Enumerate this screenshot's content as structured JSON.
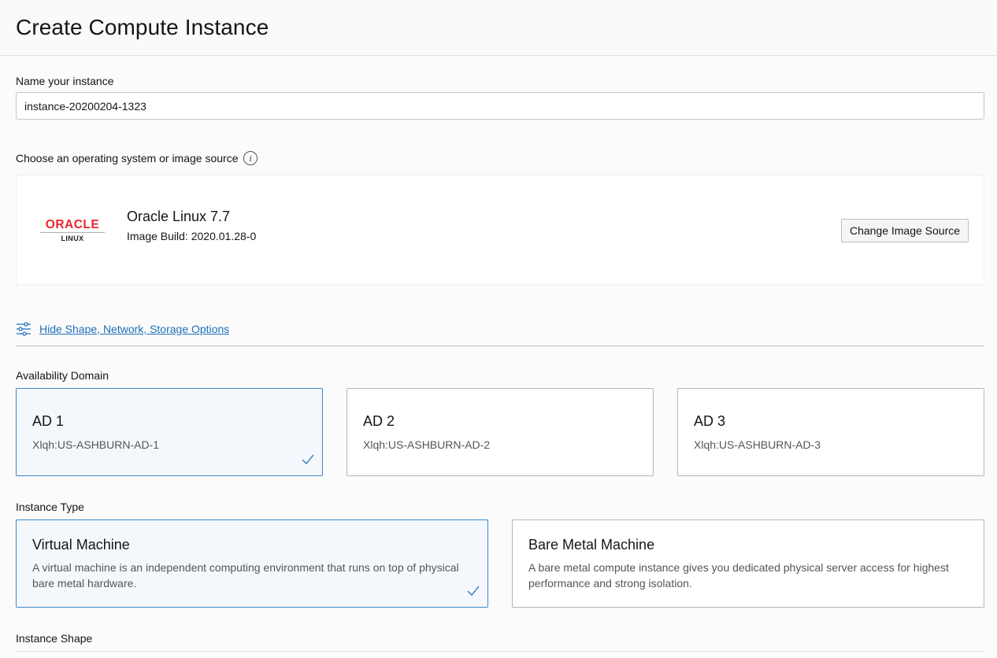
{
  "page": {
    "title": "Create Compute Instance"
  },
  "name_field": {
    "label": "Name your instance",
    "value": "instance-20200204-1323"
  },
  "image_source": {
    "label": "Choose an operating system or image source",
    "info_icon": "i",
    "logo": {
      "word": "ORACLE",
      "sub": "LINUX"
    },
    "os_name": "Oracle Linux 7.7",
    "build": "Image Build: 2020.01.28-0",
    "change_button": "Change Image Source"
  },
  "options_toggle": {
    "label": "Hide Shape, Network, Storage Options",
    "icon": "sliders-icon"
  },
  "availability_domain": {
    "label": "Availability Domain",
    "options": [
      {
        "title": "AD 1",
        "sub": "Xlqh:US-ASHBURN-AD-1",
        "selected": true
      },
      {
        "title": "AD 2",
        "sub": "Xlqh:US-ASHBURN-AD-2",
        "selected": false
      },
      {
        "title": "AD 3",
        "sub": "Xlqh:US-ASHBURN-AD-3",
        "selected": false
      }
    ]
  },
  "instance_type": {
    "label": "Instance Type",
    "options": [
      {
        "title": "Virtual Machine",
        "desc": "A virtual machine is an independent computing environment that runs on top of physical bare metal hardware.",
        "selected": true
      },
      {
        "title": "Bare Metal Machine",
        "desc": "A bare metal compute instance gives you dedicated physical server access for highest performance and strong isolation.",
        "selected": false
      }
    ]
  },
  "instance_shape": {
    "label": "Instance Shape"
  },
  "colors": {
    "accent": "#3b86c4",
    "link": "#1f6fb8",
    "oracle_red": "#e8262d",
    "selected_bg": "#f4f8fc"
  }
}
